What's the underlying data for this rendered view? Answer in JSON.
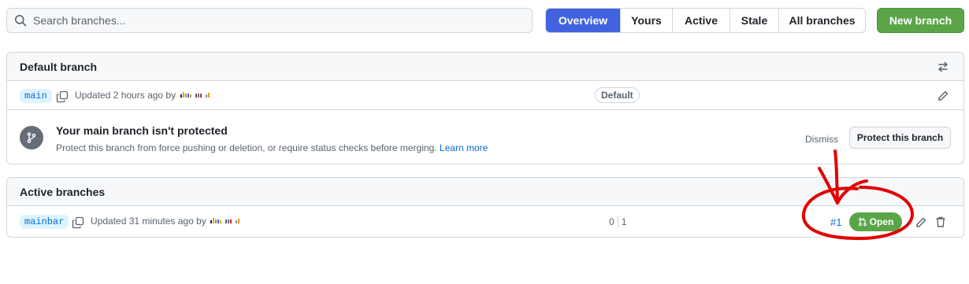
{
  "search": {
    "placeholder": "Search branches..."
  },
  "tabs": [
    {
      "label": "Overview",
      "selected": true
    },
    {
      "label": "Yours",
      "selected": false
    },
    {
      "label": "Active",
      "selected": false
    },
    {
      "label": "Stale",
      "selected": false
    },
    {
      "label": "All branches",
      "selected": false
    }
  ],
  "new_branch_label": "New branch",
  "default_section": {
    "title": "Default branch",
    "header_icon": "arrow-switch-icon",
    "branch": {
      "name": "main",
      "updated": "Updated 2 hours ago by",
      "badge": "Default"
    },
    "protection": {
      "icon": "git-branch-icon",
      "title": "Your main branch isn't protected",
      "description": "Protect this branch from force pushing or deletion, or require status checks before merging.",
      "learn_more": "Learn more",
      "dismiss": "Dismiss",
      "protect_button": "Protect this branch"
    }
  },
  "active_section": {
    "title": "Active branches",
    "branch": {
      "name": "mainbar",
      "updated": "Updated 31 minutes ago by",
      "behind": "0",
      "ahead": "1",
      "pr_number": "#1",
      "pr_status": "Open"
    }
  },
  "colors": {
    "accent": "#4263e0",
    "success": "#5aa548",
    "link": "#0969da",
    "annotation": "#e00000"
  }
}
